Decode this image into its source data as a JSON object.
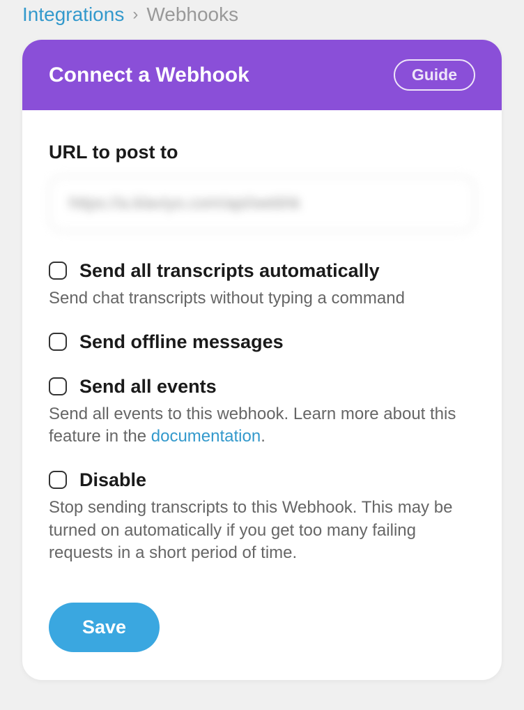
{
  "breadcrumb": {
    "link": "Integrations",
    "separator": "›",
    "current": "Webhooks"
  },
  "card": {
    "title": "Connect a Webhook",
    "guideButton": "Guide"
  },
  "form": {
    "urlLabel": "URL to post to",
    "urlValue": "https://a.klaviyo.com/api/webhk",
    "options": [
      {
        "label": "Send all transcripts automatically",
        "description": "Send chat transcripts without typing a command"
      },
      {
        "label": "Send offline messages",
        "description": ""
      },
      {
        "label": "Send all events",
        "descriptionPrefix": "Send all events to this webhook. Learn more about this feature in the ",
        "descriptionLink": "documentation",
        "descriptionSuffix": "."
      },
      {
        "label": "Disable",
        "description": "Stop sending transcripts to this Webhook. This may be turned on automatically if you get too many failing requests in a short period of time."
      }
    ],
    "saveButton": "Save"
  }
}
